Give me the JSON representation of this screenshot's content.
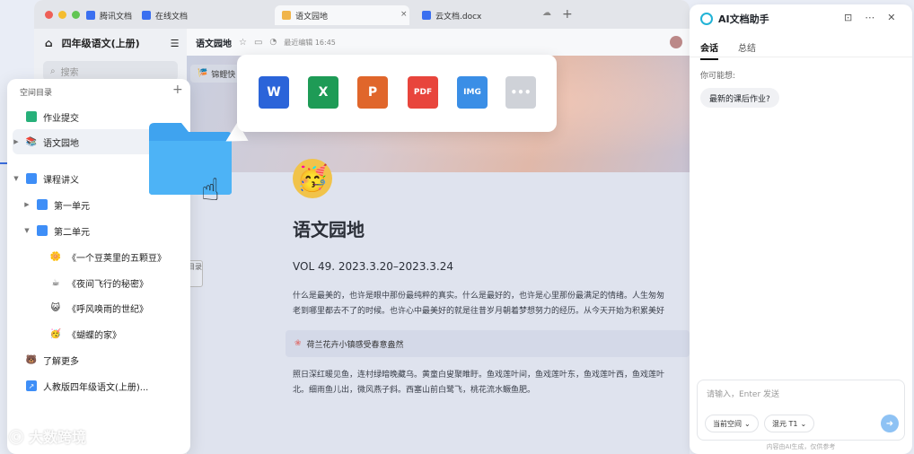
{
  "window": {
    "tabs": [
      {
        "label": "腾讯文档"
      },
      {
        "label": "在线文档"
      },
      {
        "label": "语文园地"
      },
      {
        "label": "云文档.docx"
      }
    ],
    "close_glyph": "×",
    "plus_glyph": "+"
  },
  "nav": {
    "space_title": "四年级语文(上册)",
    "search_placeholder": "搜索"
  },
  "doc": {
    "breadcrumb": "语文园地",
    "last_edit": "最近编辑 16:45",
    "title": "语文园地",
    "subtitle": "VOL 49. 2023.3.20–2023.3.24",
    "para1": "什么是最美的，也许是眼中那份最纯粹的真实。什么是最好的，也许是心里那份最满足的情绪。人生匆匆",
    "para2": "老到哪里都去不了的时候。也许心中最美好的就是往昔岁月朝着梦想努力的经历。从今天开始为积累美好",
    "callout": "荷兰花卉小镇感受春意盎然",
    "para3": "照日深红暖见鱼，连村绿暗晚藏乌。黄童白叟聚睢盱。鱼戏莲叶间，鱼戏莲叶东，鱼戏莲叶西，鱼戏莲叶",
    "para4": "北。细雨鱼儿出，微风燕子斜。西塞山前白鹭飞，桃花流水鳜鱼肥。",
    "hero_tab": "锦鲤快",
    "side_mini": "目录"
  },
  "directory": {
    "header": "空间目录",
    "add": "+",
    "items": [
      {
        "label": "作业提交",
        "icon": "sheet-icon"
      },
      {
        "label": "语文园地",
        "icon": "doc-emoji-icon"
      },
      {
        "label": "课程讲义",
        "icon": "folder-icon"
      },
      {
        "label": "第一单元",
        "icon": "folder-icon"
      },
      {
        "label": "第二单元",
        "icon": "folder-icon"
      },
      {
        "label": "《一个豆荚里的五颗豆》",
        "icon": "sun-emoji-icon"
      },
      {
        "label": "《夜间飞行的秘密》",
        "icon": "cup-emoji-icon"
      },
      {
        "label": "《呼风唤雨的世纪》",
        "icon": "face-emoji-icon"
      },
      {
        "label": "《蝴蝶的家》",
        "icon": "party-emoji-icon"
      },
      {
        "label": "了解更多",
        "icon": "bear-emoji-icon"
      },
      {
        "label": "人教版四年级语文(上册)...",
        "icon": "link-icon"
      }
    ]
  },
  "picker": {
    "apps": [
      {
        "label": "W",
        "color": "#2b64d9",
        "icon": "word-icon"
      },
      {
        "label": "X",
        "color": "#1e9b56",
        "icon": "excel-icon"
      },
      {
        "label": "P",
        "color": "#e0662b",
        "icon": "powerpoint-icon"
      },
      {
        "label": "PDF",
        "color": "#e8453c",
        "icon": "pdf-icon"
      },
      {
        "label": "IMG",
        "color": "#3a8ee6",
        "icon": "image-icon"
      },
      {
        "label": "•••",
        "color": "#cfd2d8",
        "icon": "more-icon"
      }
    ]
  },
  "ai": {
    "title": "AI文档助手",
    "tab_chat": "会话",
    "tab_summary": "总结",
    "hint": "你可能想:",
    "suggestion": "最新的课后作业?",
    "input_placeholder": "请输入，Enter 发送",
    "scope": "当前空间",
    "model": "混元 T1",
    "footer": "内容由AI生成，仅供参考"
  },
  "watermark": {
    "text": "大数跨境"
  }
}
